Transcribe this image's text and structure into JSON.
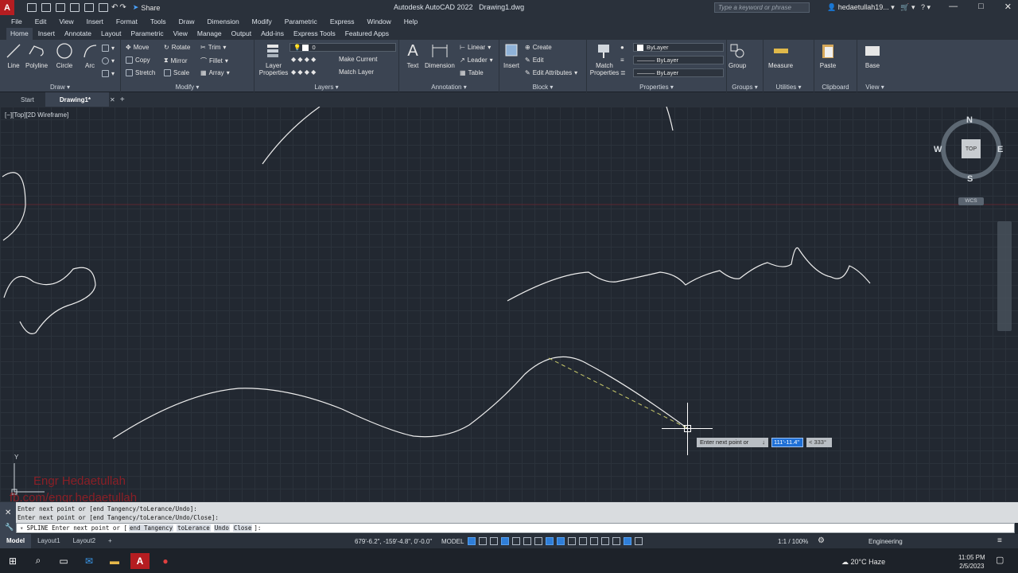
{
  "titlebar": {
    "app_logo": "A",
    "share_label": "Share",
    "title": "Autodesk AutoCAD 2022",
    "filename": "Drawing1.dwg",
    "search_placeholder": "Type a keyword or phrase",
    "user": "hedaetullah19...",
    "minimize": "—",
    "maximize": "□",
    "close": "✕"
  },
  "menubar": [
    "File",
    "Edit",
    "View",
    "Insert",
    "Format",
    "Tools",
    "Draw",
    "Dimension",
    "Modify",
    "Parametric",
    "Express",
    "Window",
    "Help"
  ],
  "ribbon_tabs": [
    "Home",
    "Insert",
    "Annotate",
    "Layout",
    "Parametric",
    "View",
    "Manage",
    "Output",
    "Add-ins",
    "Express Tools",
    "Featured Apps"
  ],
  "ribbon": {
    "draw": {
      "title": "Draw ▾",
      "line": "Line",
      "polyline": "Polyline",
      "circle": "Circle",
      "arc": "Arc"
    },
    "modify": {
      "title": "Modify ▾",
      "move": "Move",
      "rotate": "Rotate",
      "trim": "Trim",
      "copy": "Copy",
      "mirror": "Mirror",
      "fillet": "Fillet",
      "stretch": "Stretch",
      "scale": "Scale",
      "array": "Array"
    },
    "layers": {
      "title": "Layers ▾",
      "layer_properties": "Layer Properties",
      "current_layer": "0",
      "make_current": "Make Current",
      "match_layer": "Match Layer"
    },
    "annotation": {
      "title": "Annotation ▾",
      "text": "Text",
      "dimension": "Dimension",
      "linear": "Linear",
      "leader": "Leader",
      "table": "Table"
    },
    "block": {
      "title": "Block ▾",
      "insert": "Insert",
      "create": "Create",
      "edit": "Edit",
      "edit_attributes": "Edit Attributes"
    },
    "properties": {
      "title": "Properties ▾",
      "match_properties": "Match Properties",
      "color": "ByLayer",
      "linetype": "ByLayer",
      "lineweight": "ByLayer"
    },
    "groups": {
      "title": "Groups ▾",
      "group": "Group"
    },
    "utilities": {
      "title": "Utilities ▾",
      "measure": "Measure"
    },
    "clipboard": {
      "title": "Clipboard",
      "paste": "Paste"
    },
    "view": {
      "title": "View ▾",
      "base": "Base"
    }
  },
  "file_tabs": {
    "start": "Start",
    "drawing": "Drawing1*",
    "close": "✕",
    "new": "+"
  },
  "viewport": {
    "label": "[−][Top][2D Wireframe]",
    "viewcube": {
      "n": "N",
      "s": "S",
      "e": "E",
      "w": "W",
      "top": "TOP"
    },
    "wcs": "WCS",
    "ucs_y": "Y",
    "watermark_line1": "Engr Hedaetullah",
    "watermark_line2": "fb.com/engr.hedaetullah"
  },
  "dynamic_input": {
    "prompt": "Enter next point or",
    "value": "111'-11.4\"",
    "angle": "< 333°"
  },
  "command_history": [
    "Enter next point or [end Tangency/toLerance/Undo]:",
    "Enter next point or [end Tangency/toLerance/Undo/Close]:"
  ],
  "command_line": {
    "prefix": "SPLINE Enter next point or [",
    "options": [
      "end Tangency",
      "toLerance",
      "Undo",
      "Close"
    ],
    "suffix": "]:"
  },
  "statusbar": {
    "layouts": [
      "Model",
      "Layout1",
      "Layout2"
    ],
    "add_layout": "+",
    "coords": "679'-6.2\", -159'-4.8\", 0'-0.0\"",
    "model": "MODEL",
    "scale": "1:1 / 100%",
    "units": "Engineering"
  },
  "taskbar": {
    "weather": "20°C  Haze",
    "time": "11:05 PM",
    "date": "2/5/2023"
  },
  "colors": {
    "accent": "#2f7ed8",
    "canvas": "#222831",
    "ribbon": "#3b4452",
    "watermark": "#8a1f26"
  }
}
